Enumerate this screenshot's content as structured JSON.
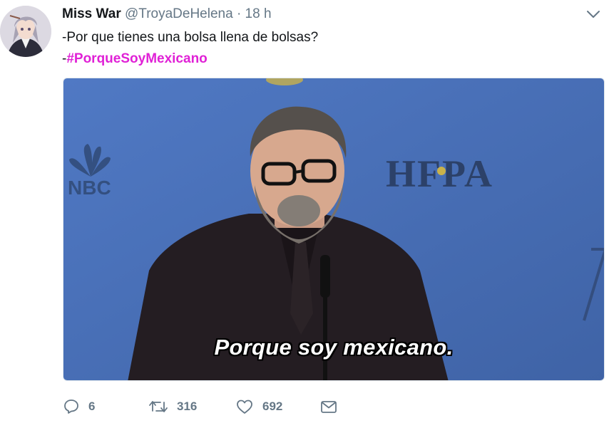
{
  "tweet": {
    "display_name": "Miss War",
    "handle": "@TroyaDeHelena",
    "separator": "·",
    "time": "18 h",
    "text_line1": "-Por que tienes una bolsa llena de bolsas?",
    "text_line2_prefix": "-",
    "hashtag": "#PorqueSoyMexicano"
  },
  "media": {
    "subtitle": "Porque soy mexicano.",
    "backdrop_logos": [
      "NBC",
      "HFPA"
    ]
  },
  "actions": {
    "replies": "6",
    "retweets": "316",
    "likes": "692"
  },
  "colors": {
    "hashtag": "#e021d6",
    "muted": "#657786",
    "backdrop_blue": "#4a6fb5"
  },
  "icons": [
    "chevron-down-icon",
    "reply-icon",
    "retweet-icon",
    "like-icon",
    "message-icon"
  ]
}
